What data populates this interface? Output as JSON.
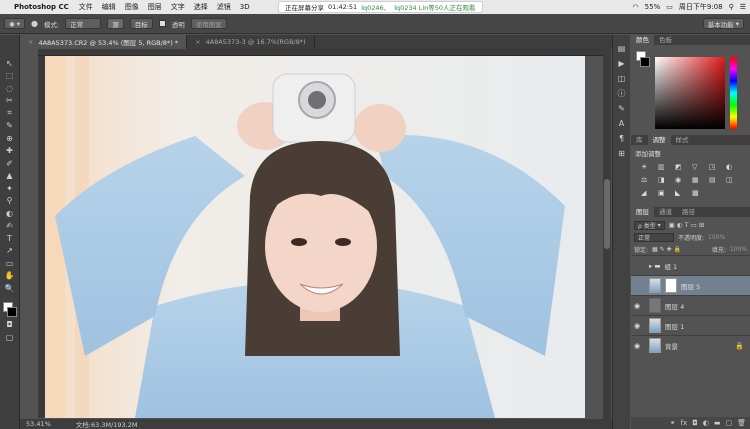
{
  "menubar": {
    "app_name": "Photoshop CC",
    "items": [
      "文件",
      "编辑",
      "图像",
      "图层",
      "文字",
      "选择",
      "滤镜",
      "3D"
    ],
    "share": {
      "prefix": "正在屏幕分享",
      "time": "01:42:51",
      "id1": "lq0246、",
      "id2": "lq0234 Lin等50人正在观看"
    },
    "battery": "55%",
    "clock": "周日下午9:08"
  },
  "options": {
    "mode_label": "模式:",
    "mode_value": "正常",
    "btn1": "源",
    "btn2": "目标",
    "transparent": "透明",
    "use_pattern": "使用图案",
    "workspace": "基本功能"
  },
  "tabs": [
    {
      "label": "4A8A5373.CR2 @ 53.4% (图层 5, RGB/8*) *",
      "active": true
    },
    {
      "label": "4A8A5373-3 @ 16.7%(RGB/8*)",
      "active": false
    }
  ],
  "tools": [
    "↖",
    "⬚",
    "◌",
    "✂",
    "⌗",
    "✎",
    "⊕",
    "✚",
    "✐",
    "▲",
    "✦",
    "⚲",
    "◐",
    "✍",
    "T",
    "↗",
    "▭",
    "✋",
    "🔍"
  ],
  "color_panel": {
    "tabs": [
      "颜色",
      "色板"
    ]
  },
  "adjustments": {
    "tabs": [
      "库",
      "调整",
      "样式"
    ],
    "title": "添加调整",
    "icons": [
      "☀",
      "▥",
      "◩",
      "▽",
      "◳",
      "◐",
      "⚖",
      "◨",
      "◉",
      "▦",
      "▤",
      "◫",
      "◢",
      "▣",
      "◣",
      "▩"
    ]
  },
  "layers": {
    "tabs": [
      "图层",
      "通道",
      "路径"
    ],
    "kind": "ρ 类型",
    "blend": "正常",
    "opacity_label": "不透明度:",
    "opacity_value": "100%",
    "lock_label": "锁定:",
    "fill_label": "填充:",
    "fill_value": "100%",
    "items": [
      {
        "name": "组 1",
        "type": "group"
      },
      {
        "name": "图层 5",
        "type": "masked",
        "selected": true
      },
      {
        "name": "图层 4",
        "type": "gray"
      },
      {
        "name": "图层 1",
        "type": "image"
      },
      {
        "name": "背景",
        "type": "background"
      }
    ]
  },
  "status": {
    "zoom": "53.41%",
    "doc": "文档:63.3M/193.2M"
  }
}
